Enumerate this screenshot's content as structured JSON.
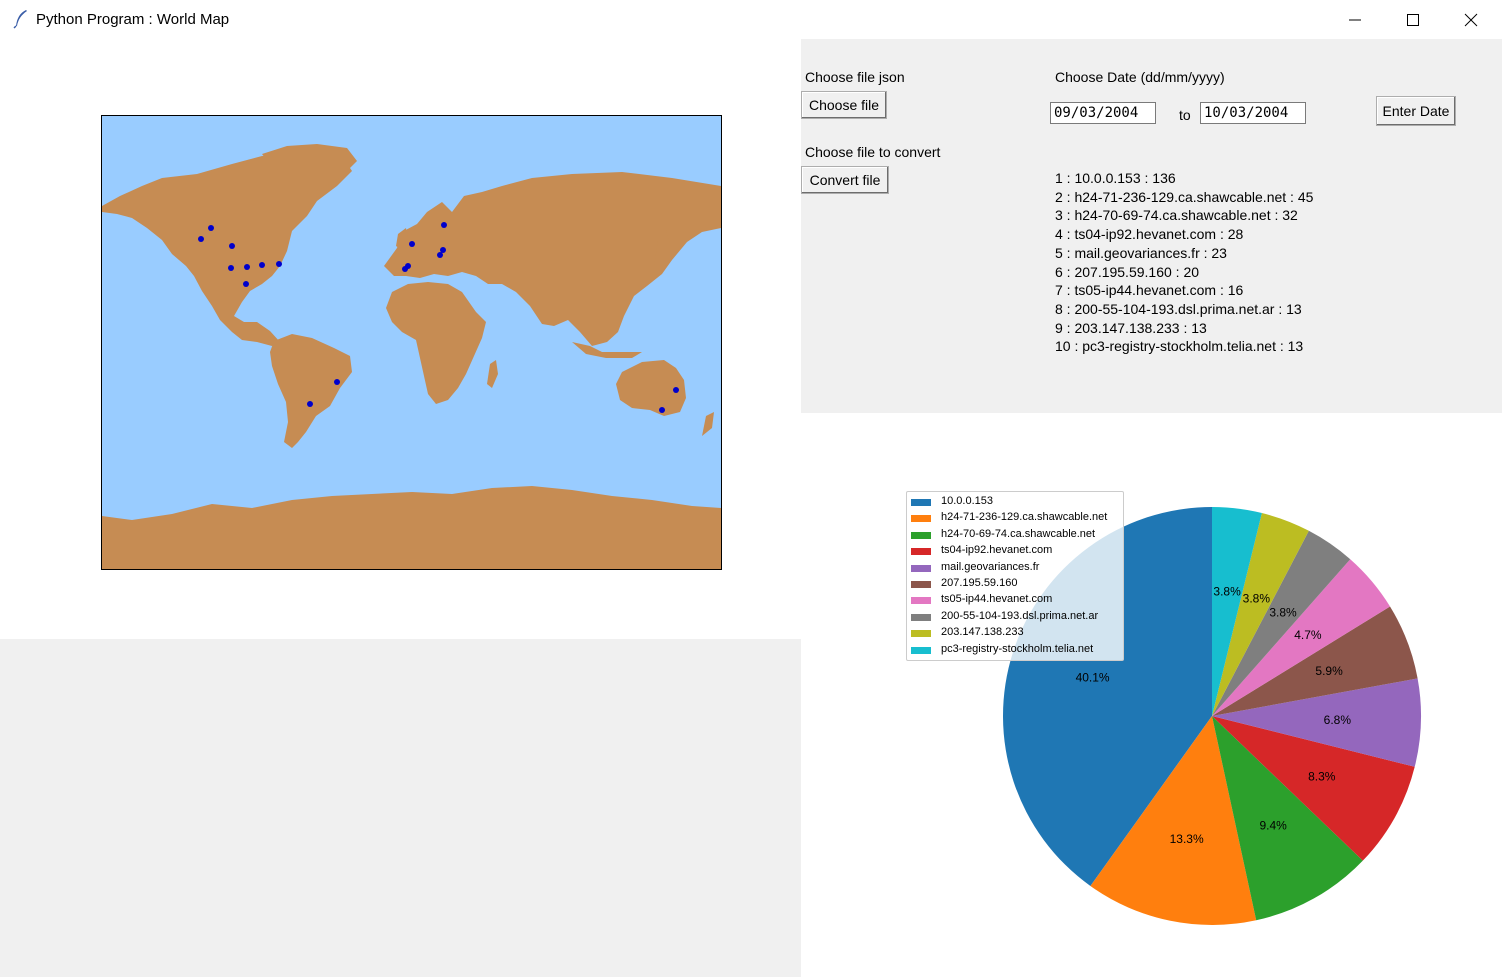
{
  "window": {
    "title": "Python Program : World Map",
    "icon": "feather-icon",
    "controls": [
      "minimize-icon",
      "maximize-icon",
      "close-icon"
    ]
  },
  "map": {
    "ocean_color": "#99ccff",
    "land_color": "#c68c53",
    "marker_color": "#0000cc"
  },
  "controls": {
    "json_label": "Choose file json",
    "json_button": "Choose file",
    "convert_label": "Choose file to convert",
    "convert_button": "Convert file",
    "date_label": "Choose Date (dd/mm/yyyy)",
    "date_from": "09/03/2004",
    "date_to_label": "to",
    "date_to": "10/03/2004",
    "enter_date_button": "Enter Date"
  },
  "results": [
    "1 : 10.0.0.153 : 136",
    "2 : h24-71-236-129.ca.shawcable.net : 45",
    "3 : h24-70-69-74.ca.shawcable.net : 32",
    "4 : ts04-ip92.hevanet.com : 28",
    "5 : mail.geovariances.fr : 23",
    "6 : 207.195.59.160 : 20",
    "7 : ts05-ip44.hevanet.com : 16",
    "8 : 200-55-104-193.dsl.prima.net.ar : 13",
    "9 : 203.147.138.233 : 13",
    "10 : pc3-registry-stockholm.telia.net : 13"
  ],
  "chart_data": {
    "type": "pie",
    "title": "",
    "labels": [
      "10.0.0.153",
      "h24-71-236-129.ca.shawcable.net",
      "h24-70-69-74.ca.shawcable.net",
      "ts04-ip92.hevanet.com",
      "mail.geovariances.fr",
      "207.195.59.160",
      "ts05-ip44.hevanet.com",
      "200-55-104-193.dsl.prima.net.ar",
      "203.147.138.233",
      "pc3-registry-stockholm.telia.net"
    ],
    "values": [
      136,
      45,
      32,
      28,
      23,
      20,
      16,
      13,
      13,
      13
    ],
    "percent_labels": [
      "40.1%",
      "13.3%",
      "9.4%",
      "8.3%",
      "6.8%",
      "5.9%",
      "4.7%",
      "3.8%",
      "3.8%",
      "3.8%"
    ],
    "colors": [
      "#1f77b4",
      "#ff7f0e",
      "#2ca02c",
      "#d62728",
      "#9467bd",
      "#8c564b",
      "#e377c2",
      "#7f7f7f",
      "#bcbd22",
      "#17becf"
    ],
    "start_angle_deg": 90,
    "direction": "counterclockwise",
    "legend_position": "upper-left"
  }
}
